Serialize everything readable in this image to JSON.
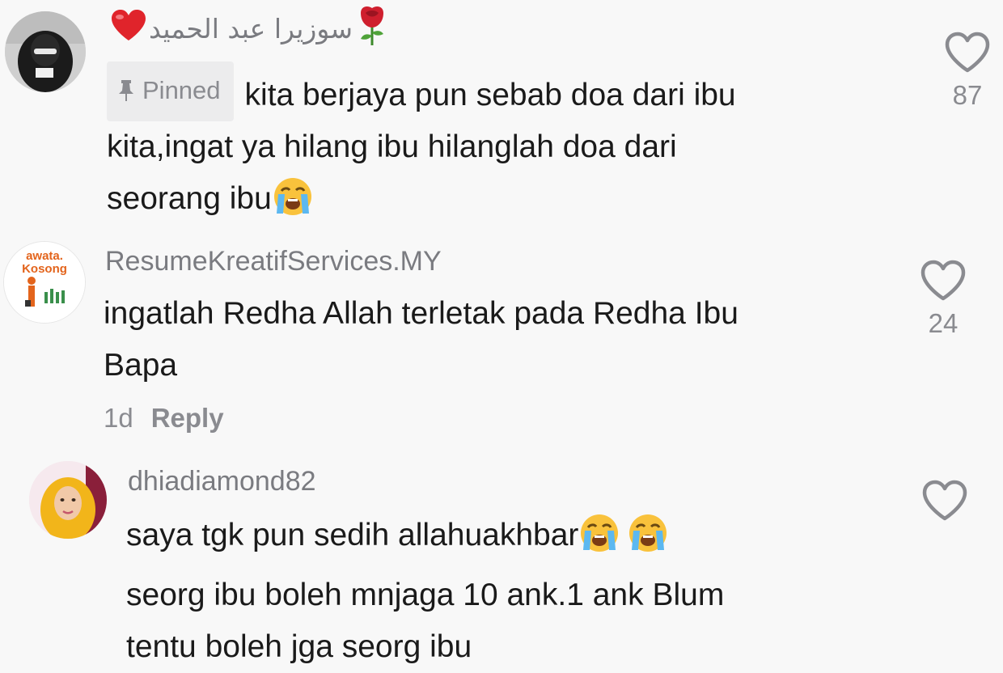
{
  "comments": [
    {
      "username": "سوزيرا عبد الحميد",
      "pinned_label": "Pinned",
      "line1": "kita berjaya pun sebab doa dari ibu",
      "line2": "kita,ingat ya hilang ibu hilanglah doa dari",
      "line3": "seorang ibu",
      "likes": "87"
    },
    {
      "username": "ResumeKreatifServices.MY",
      "avatar_text_top": "awata.",
      "avatar_text_bottom": "Kosong",
      "line1": "ingatlah Redha Allah terletak pada Redha Ibu",
      "line2": "Bapa",
      "likes": "24",
      "time": "1d",
      "reply_label": "Reply"
    },
    {
      "username": "dhiadiamond82",
      "line1": "saya tgk pun sedih allahuakhbar",
      "line2": "seorg ibu boleh mnjaga 10 ank.1 ank Blum",
      "line3": "tentu boleh jga seorg ibu"
    }
  ],
  "colors": {
    "background": "#f8f8f8",
    "text": "#1a1a1a",
    "muted": "#8a8b90",
    "pinned_bg": "#ececed"
  },
  "icons": [
    "heart-icon",
    "pin-icon",
    "rose-icon",
    "crying-face-icon",
    "red-heart-icon"
  ]
}
